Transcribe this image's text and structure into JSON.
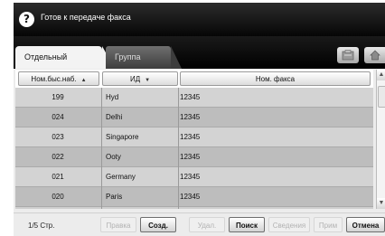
{
  "header": {
    "title": "Готов к передаче факса",
    "help_glyph": "?"
  },
  "tabs": [
    {
      "label": "Отдельный",
      "active": true
    },
    {
      "label": "Группа",
      "active": false
    }
  ],
  "toolbar": {
    "icons": [
      "address-book-icon",
      "home-icon"
    ]
  },
  "table": {
    "columns": [
      {
        "label": "Ном.быс.наб.",
        "sort": "▲"
      },
      {
        "label": "ИД",
        "sort": "▼"
      },
      {
        "label": "Ном. факса",
        "sort": ""
      }
    ],
    "rows": [
      {
        "speed": "199",
        "id": "Hyd",
        "fax": "12345"
      },
      {
        "speed": "024",
        "id": "Delhi",
        "fax": "12345"
      },
      {
        "speed": "023",
        "id": "Singapore",
        "fax": "12345"
      },
      {
        "speed": "022",
        "id": "Ooty",
        "fax": "12345"
      },
      {
        "speed": "021",
        "id": "Germany",
        "fax": "12345"
      },
      {
        "speed": "020",
        "id": "Paris",
        "fax": "12345"
      }
    ]
  },
  "footer": {
    "page_label": "1/5 Стр.",
    "buttons": [
      {
        "label": "Правка",
        "enabled": false
      },
      {
        "label": "Созд.",
        "enabled": true
      },
      {
        "label": "Удал.",
        "enabled": false
      },
      {
        "label": "Поиск",
        "enabled": true
      },
      {
        "label": "Сведения",
        "enabled": false
      },
      {
        "label": "Прим",
        "enabled": false
      },
      {
        "label": "Отмена",
        "enabled": true
      }
    ]
  },
  "colors": {
    "title_bar": "#060606",
    "row_odd": "#d3d3d3",
    "row_even": "#bdbdbd"
  }
}
